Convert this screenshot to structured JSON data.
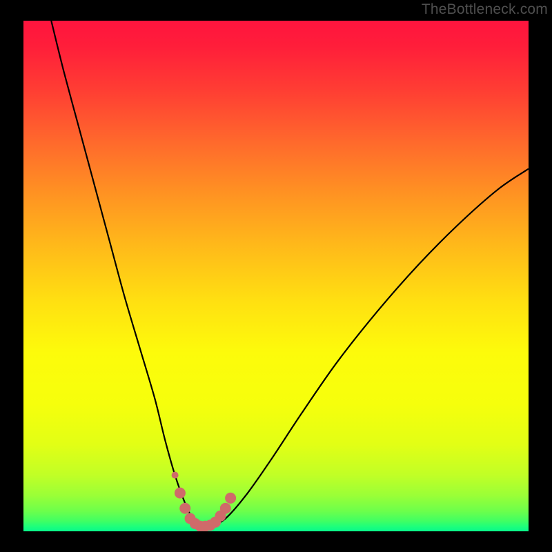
{
  "watermark": "TheBottleneck.com",
  "chart_data": {
    "type": "line",
    "title": "",
    "xlabel": "",
    "ylabel": "",
    "xlim": [
      0,
      100
    ],
    "ylim": [
      0,
      100
    ],
    "background_gradient": {
      "top": "#ff143e",
      "bottom": "#08f98b",
      "note": "vertical rainbow heat gradient (red top → green bottom) representing bottleneck severity"
    },
    "series": [
      {
        "name": "bottleneck-curve",
        "stroke": "#000000",
        "stroke_width": 2.2,
        "x": [
          5.5,
          8,
          11,
          14,
          17,
          20,
          23,
          26,
          28,
          30,
          32,
          33.5,
          35,
          37,
          40,
          44,
          49,
          55,
          62,
          70,
          78,
          86,
          94,
          100
        ],
        "values": [
          100,
          90,
          79,
          68,
          57,
          46,
          36,
          26,
          18,
          11,
          5.5,
          2.5,
          1,
          1,
          2.5,
          7,
          14,
          23,
          33,
          43,
          52,
          60,
          67,
          71
        ]
      }
    ],
    "markers": {
      "name": "highlighted-range",
      "color": "#cf6a6a",
      "radius_small": 5,
      "radius_large": 8,
      "x": [
        30,
        31,
        32,
        33,
        34,
        35,
        36,
        37,
        38,
        39,
        40,
        41
      ],
      "values": [
        11,
        7.5,
        4.5,
        2.5,
        1.5,
        1,
        1,
        1.2,
        1.8,
        3,
        4.5,
        6.5
      ]
    }
  }
}
